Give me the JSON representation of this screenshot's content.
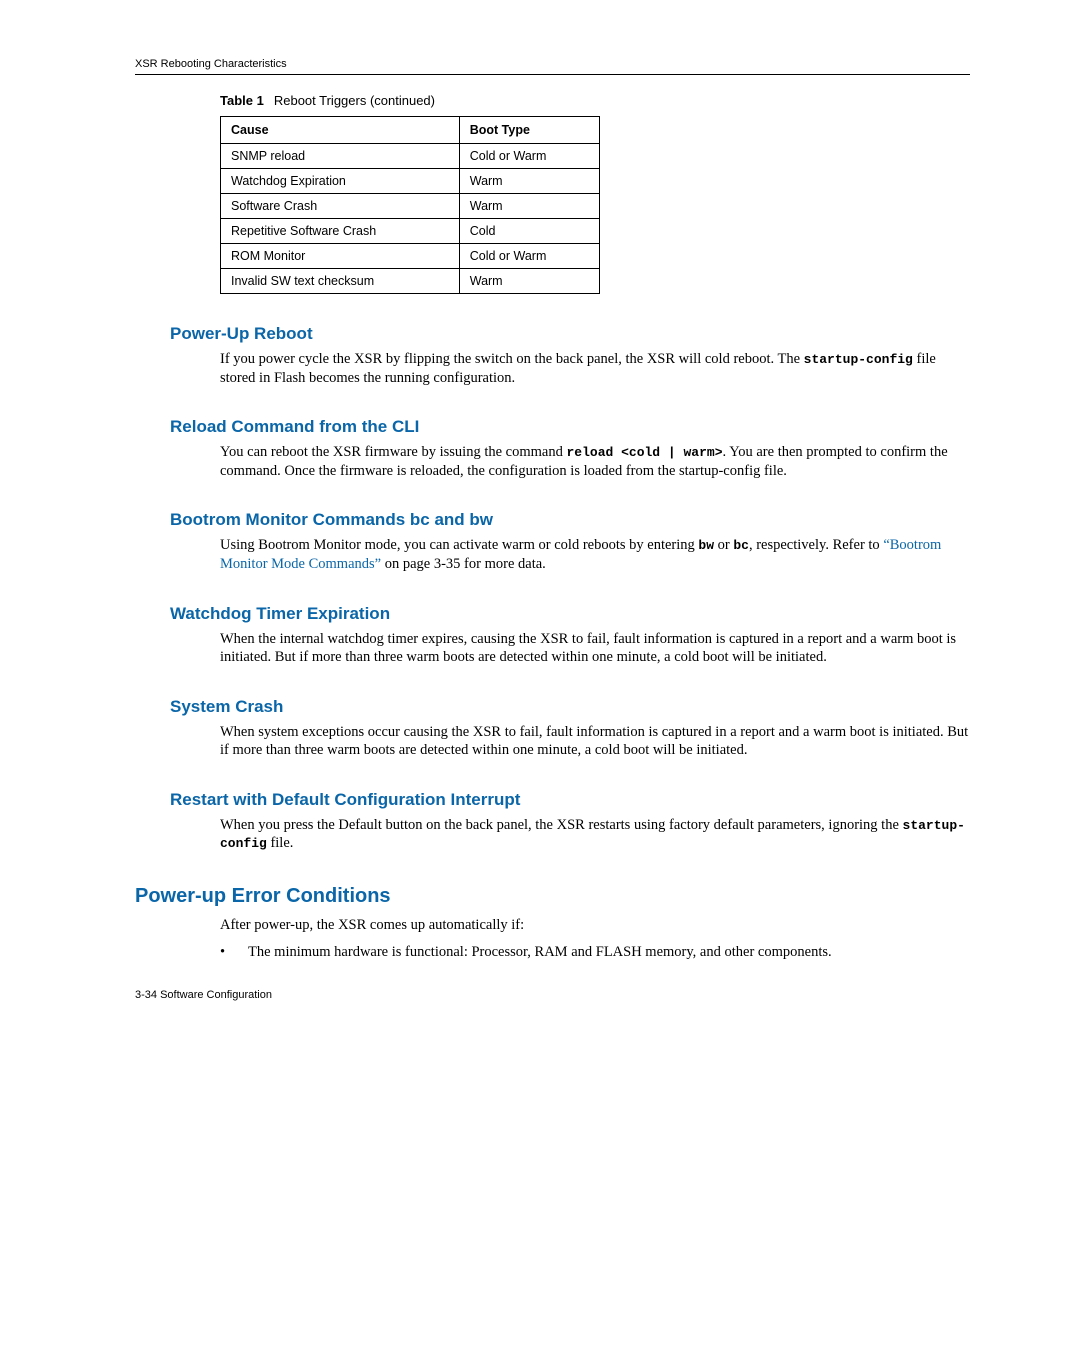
{
  "running_head": "XSR Rebooting Characteristics",
  "table": {
    "caption_label": "Table 1",
    "caption_text": "Reboot Triggers (continued)",
    "headers": [
      "Cause",
      "Boot Type"
    ],
    "rows": [
      [
        "SNMP reload",
        "Cold or Warm"
      ],
      [
        "Watchdog Expiration",
        "Warm"
      ],
      [
        "Software Crash",
        "Warm"
      ],
      [
        "Repetitive Software Crash",
        "Cold"
      ],
      [
        "ROM Monitor",
        "Cold or Warm"
      ],
      [
        "Invalid SW text checksum",
        "Warm"
      ]
    ]
  },
  "sections": {
    "powerup": {
      "title": "Power-Up Reboot",
      "p1a": "If you power cycle the XSR by flipping the switch on the back panel, the XSR will cold reboot. The ",
      "code": "startup-config",
      "p1b": " file stored in Flash becomes the running configuration."
    },
    "reload": {
      "title": "Reload Command from the CLI",
      "p1a": "You can reboot the XSR firmware by issuing the command ",
      "code": "reload <cold | warm>",
      "p1b": ". You are then prompted to confirm the command. Once the firmware is reloaded, the configuration is loaded from the startup-config file."
    },
    "bootrom": {
      "title": "Bootrom Monitor Commands bc and bw",
      "p1a": "Using Bootrom Monitor mode, you can activate warm or cold reboots by entering ",
      "code1": "bw",
      "mid": " or ",
      "code2": "bc",
      "p1b": ", respectively. Refer to ",
      "link": "“Bootrom Monitor Mode Commands”",
      "p1c": " on page 3-35 for more data."
    },
    "watchdog": {
      "title": "Watchdog Timer Expiration",
      "p1": "When the internal watchdog timer expires, causing the XSR to fail, fault information is captured in a report and a warm boot is initiated. But if more than three warm boots are detected within one minute, a cold boot will be initiated."
    },
    "crash": {
      "title": "System Crash",
      "p1": "When system exceptions occur causing the XSR to fail, fault information is captured in a report and a warm boot is initiated. But if more than three warm boots are detected within one minute, a cold boot will be initiated."
    },
    "restart": {
      "title": "Restart with Default Configuration Interrupt",
      "p1a": "When you press the Default button on the back panel, the XSR restarts using factory default parameters, ignoring the ",
      "code": "startup-config",
      "p1b": " file."
    },
    "errcond": {
      "title": "Power-up Error Conditions",
      "p1": "After power-up, the XSR comes up automatically if:",
      "bullet1": "The minimum hardware is functional: Processor, RAM and FLASH memory, and other components."
    }
  },
  "footer": "3-34   Software Configuration"
}
